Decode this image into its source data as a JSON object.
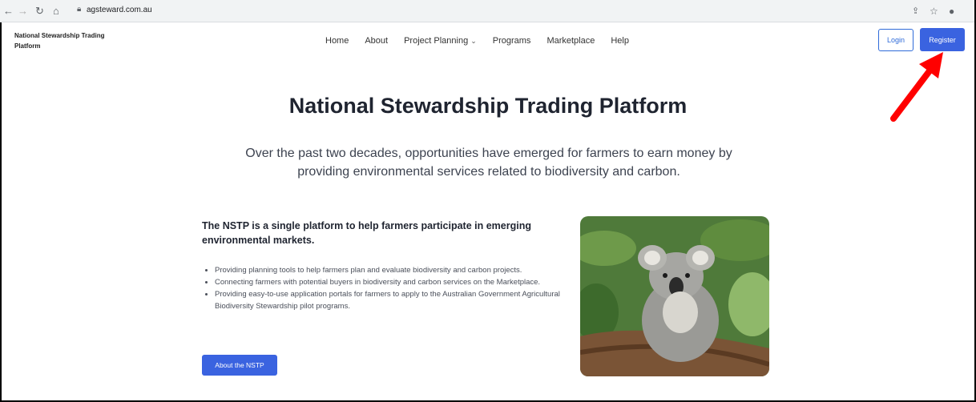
{
  "browser": {
    "url": "agsteward.com.au",
    "icons": [
      "back-icon",
      "forward-icon",
      "reload-icon",
      "home-icon",
      "lock-icon",
      "share-icon",
      "star-icon",
      "profile-icon"
    ]
  },
  "site": {
    "brand": "National Stewardship Trading Platform",
    "nav": [
      {
        "label": "Home"
      },
      {
        "label": "About"
      },
      {
        "label": "Project Planning",
        "has_dropdown": true
      },
      {
        "label": "Programs"
      },
      {
        "label": "Marketplace"
      },
      {
        "label": "Help"
      }
    ],
    "login_label": "Login",
    "register_label": "Register"
  },
  "hero": {
    "title": "National Stewardship Trading Platform",
    "subtitle": "Over the past two decades, opportunities have emerged for farmers to earn money by providing environmental services related to biodiversity and carbon."
  },
  "content": {
    "lead": "The NSTP is a single platform to help farmers participate in emerging environmental markets.",
    "bullets": [
      "Providing planning tools to help farmers plan and evaluate biodiversity and carbon projects.",
      "Connecting farmers with potential buyers in biodiversity and carbon services on the Marketplace.",
      "Providing easy-to-use application portals for farmers to apply to the Australian Government Agricultural Biodiversity Stewardship pilot programs."
    ],
    "about_button": "About the NSTP"
  },
  "colors": {
    "primary": "#3a63e0",
    "annotation_arrow": "#ff0000"
  }
}
